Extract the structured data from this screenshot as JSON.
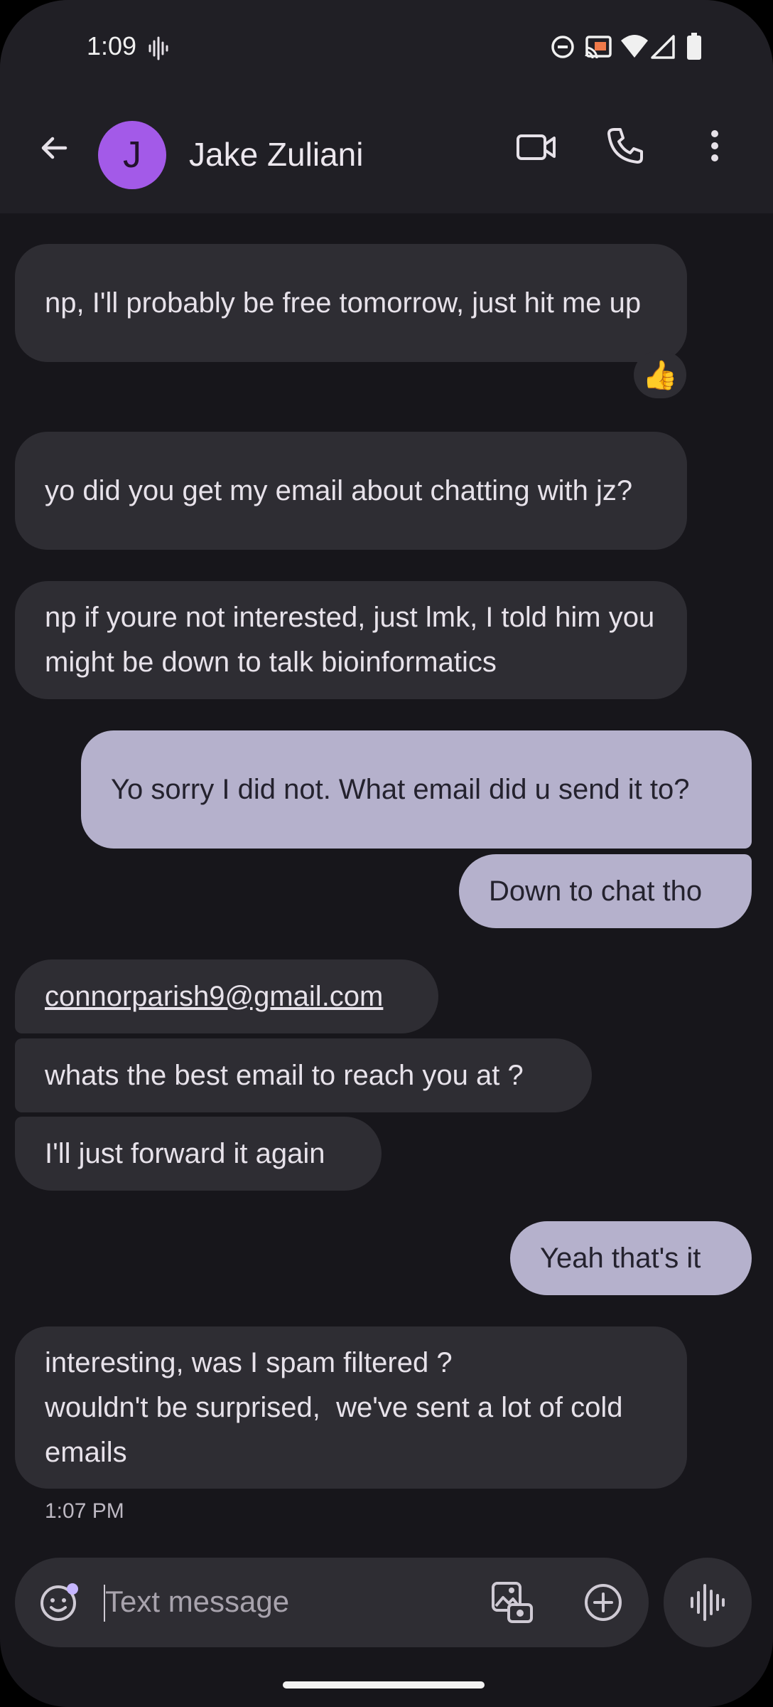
{
  "status_bar": {
    "time": "1:09"
  },
  "header": {
    "avatar_initial": "J",
    "contact_name": "Jake Zuliani"
  },
  "icons": {
    "back": "arrow-back-icon",
    "video": "video-call-icon",
    "phone": "phone-icon",
    "more": "more-vert-icon",
    "emoji": "emoji-icon",
    "gallery": "gallery-icon",
    "add": "add-circle-icon",
    "voice": "voice-waveform-icon"
  },
  "messages": [
    {
      "direction": "incoming",
      "text": "np, I'll probably be free tomorrow, just hit me up",
      "reaction": "👍"
    },
    {
      "direction": "incoming",
      "text": "yo did you get my email about chatting with jz?"
    },
    {
      "direction": "incoming",
      "text": "np if youre not interested, just lmk, I told him you might be down to talk bioinformatics"
    },
    {
      "direction": "outgoing",
      "text": "Yo sorry I did not. What email did u send it to?"
    },
    {
      "direction": "outgoing",
      "text": "Down to chat tho"
    },
    {
      "direction": "incoming",
      "text": "connorparish9@gmail.com",
      "is_link": true
    },
    {
      "direction": "incoming",
      "text": "whats the best email to reach you at ?"
    },
    {
      "direction": "incoming",
      "text": "I'll just forward it again"
    },
    {
      "direction": "outgoing",
      "text": "Yeah that's it"
    },
    {
      "direction": "incoming",
      "text": "interesting, was I spam filtered ?\nwouldn't be surprised,  we've sent a lot of cold emails"
    }
  ],
  "last_timestamp": "1:07 PM",
  "composer": {
    "placeholder": "Text message"
  },
  "colors": {
    "background": "#17161b",
    "bar": "#201f25",
    "incoming_bubble": "#2e2d33",
    "outgoing_bubble": "#b5b1cc",
    "avatar": "#a35ae8"
  }
}
